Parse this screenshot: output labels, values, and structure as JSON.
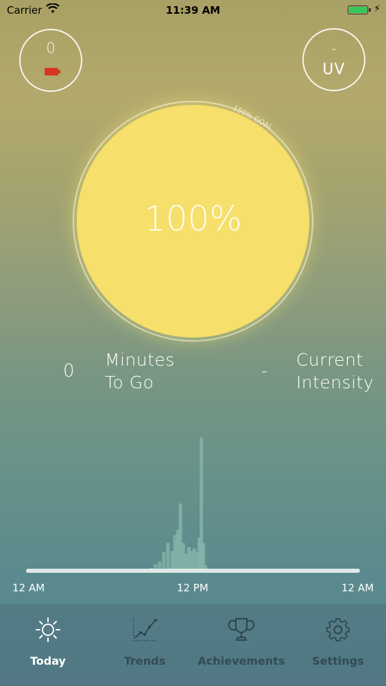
{
  "status_bar": {
    "carrier": "Carrier",
    "time": "11:39 AM"
  },
  "left_button": {
    "value": "0",
    "icon": "battery-low-icon",
    "battery_color": "#d6351f"
  },
  "right_button": {
    "value": "-",
    "label": "UV"
  },
  "sun": {
    "percent": "100%",
    "goal_label": "100% GOAL",
    "fill_color": "#f6df6a"
  },
  "stats": {
    "minutes": {
      "value": "0",
      "line1": "Minutes",
      "line2": "To Go"
    },
    "intensity": {
      "value": "-",
      "line1": "Current",
      "line2": "Intensity"
    }
  },
  "timeline": {
    "ticks": [
      "12 AM",
      "12 PM",
      "12 AM"
    ],
    "chart_data": {
      "type": "area",
      "x_range": [
        0,
        24
      ],
      "x": [
        9.0,
        9.3,
        9.6,
        9.9,
        10.2,
        10.5,
        10.7,
        10.9,
        11.1,
        11.3,
        11.5,
        11.7,
        11.9,
        12.1,
        12.3,
        12.45,
        12.6,
        12.75,
        12.9
      ],
      "values": [
        0.01,
        0.04,
        0.06,
        0.13,
        0.2,
        0.14,
        0.26,
        0.3,
        0.5,
        0.2,
        0.12,
        0.17,
        0.14,
        0.16,
        0.13,
        0.24,
        1.0,
        0.2,
        0.03
      ],
      "series_color": "#8ab8ae"
    }
  },
  "tabs": [
    {
      "label": "Today",
      "icon": "sun-icon",
      "active": true
    },
    {
      "label": "Trends",
      "icon": "trend-chart-icon",
      "active": false
    },
    {
      "label": "Achievements",
      "icon": "trophy-icon",
      "active": false
    },
    {
      "label": "Settings",
      "icon": "gear-icon",
      "active": false
    }
  ]
}
